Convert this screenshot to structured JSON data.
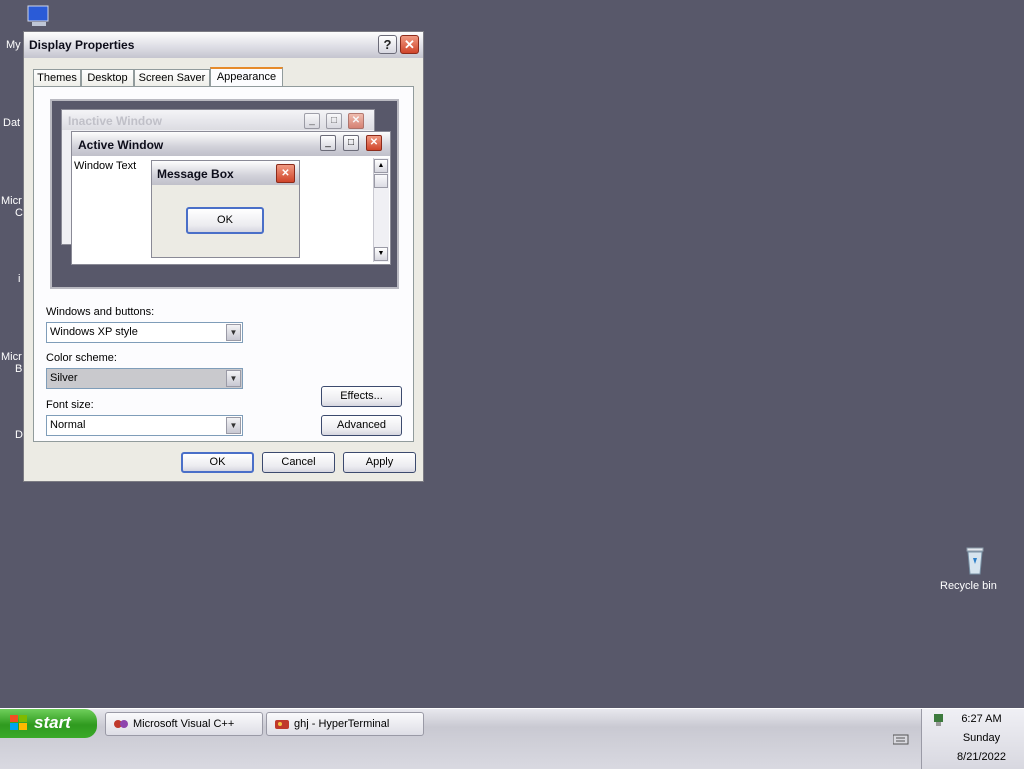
{
  "desktop": {
    "icons_left": [
      {
        "label": "My",
        "name": "my-computer"
      },
      {
        "label": "Dat",
        "name": "data"
      },
      {
        "label": "Micr",
        "name": "microsoft-1"
      },
      {
        "label": "C",
        "name": "microsoft-1b"
      },
      {
        "label": "i",
        "name": "i-icon"
      },
      {
        "label": "Micr",
        "name": "microsoft-2"
      },
      {
        "label": "B",
        "name": "microsoft-2b"
      },
      {
        "label": "D",
        "name": "d-icon"
      }
    ],
    "recycle_bin": "Recycle bin"
  },
  "dialog": {
    "title": "Display Properties",
    "help_glyph": "?",
    "close_glyph": "✕",
    "tabs": [
      "Themes",
      "Desktop",
      "Screen Saver",
      "Appearance"
    ],
    "active_tab": "Appearance",
    "preview": {
      "inactive_title": "Inactive Window",
      "active_title": "Active Window",
      "window_text": "Window Text",
      "message_box_title": "Message Box",
      "message_ok": "OK"
    },
    "windows_buttons_label": "Windows and buttons:",
    "windows_buttons_value": "Windows XP style",
    "color_scheme_label": "Color scheme:",
    "color_scheme_value": "Silver",
    "font_size_label": "Font size:",
    "font_size_value": "Normal",
    "effects_label": "Effects...",
    "advanced_label": "Advanced",
    "ok_label": "OK",
    "cancel_label": "Cancel",
    "apply_label": "Apply"
  },
  "taskbar": {
    "start_label": "start",
    "tasks": [
      "Microsoft Visual C++",
      "ghj - HyperTerminal"
    ],
    "time": "6:27 AM",
    "day": "Sunday",
    "date": "8/21/2022"
  },
  "colors": {
    "desktop_bg": "#58586a",
    "window_face": "#ecebe4",
    "tab_active_accent": "#e68b2c",
    "start_green": "#2f9a1f"
  }
}
